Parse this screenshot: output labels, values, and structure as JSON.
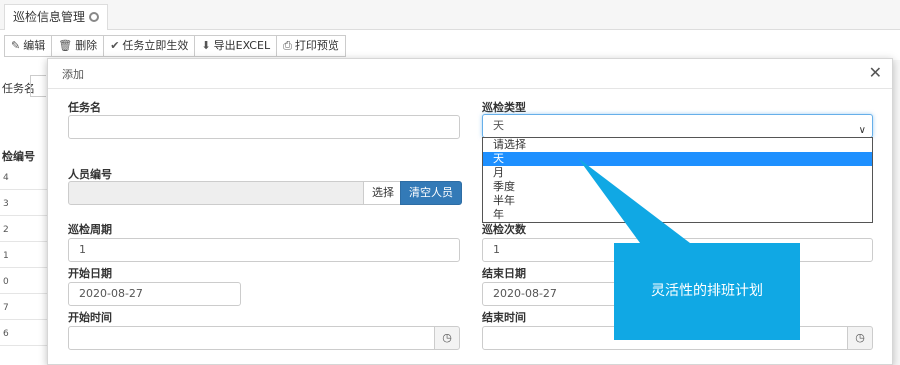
{
  "tab": {
    "label": "巡检信息管理"
  },
  "toolbar": {
    "edit": "编辑",
    "delete": "删除",
    "activate": "任务立即生效",
    "export": "导出EXCEL",
    "print": "打印预览"
  },
  "background": {
    "task_label": "任务名",
    "code_header": "检编号",
    "row_ids": [
      "4",
      "3",
      "2",
      "1",
      "0",
      "7",
      "6"
    ]
  },
  "modal": {
    "title": "添加",
    "close_icon": "close-icon",
    "task_name": {
      "label": "任务名",
      "value": ""
    },
    "inspection_type": {
      "label": "巡检类型",
      "value": "天",
      "options": [
        "请选择",
        "天",
        "月",
        "季度",
        "半年",
        "年"
      ],
      "selected_index": 1
    },
    "staff_no": {
      "label": "人员编号",
      "value": "",
      "select_btn": "选择",
      "clear_btn": "清空人员"
    },
    "period": {
      "label": "巡检周期",
      "value": "1"
    },
    "count": {
      "label": "巡检次数",
      "value": "1"
    },
    "start_date": {
      "label": "开始日期",
      "value": "2020-08-27"
    },
    "end_date": {
      "label": "结束日期",
      "value": "2020-08-27"
    },
    "start_time": {
      "label": "开始时间",
      "value": ""
    },
    "end_time": {
      "label": "结束时间",
      "value": ""
    }
  },
  "callout": {
    "text": "灵活性的排班计划",
    "color": "#10a8e4"
  }
}
